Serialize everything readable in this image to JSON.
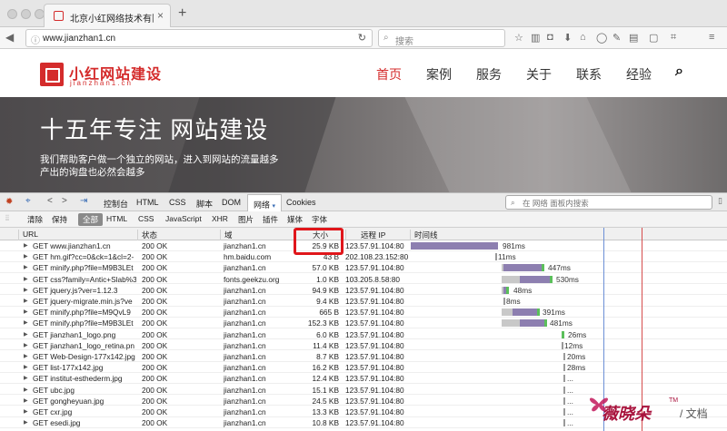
{
  "browser": {
    "tab_title": "北京小红网络技术有限公司-...",
    "url": "www.jianzhan1.cn",
    "search_placeholder": "搜索"
  },
  "site": {
    "logo_title": "小红网站建设",
    "logo_subtitle": "jianzhan1.cn",
    "menu": [
      "首页",
      "案例",
      "服务",
      "关于",
      "联系",
      "经验"
    ],
    "active_menu": "首页",
    "hero_title": "十五年专注 网站建设",
    "hero_desc_line1": "我们帮助客户做一个独立的网站，进入到网站的流量越多",
    "hero_desc_line2": "产出的询盘也必然会越多"
  },
  "devtools": {
    "tabs": [
      "控制台",
      "HTML",
      "CSS",
      "脚本",
      "DOM",
      "网络",
      "Cookies"
    ],
    "active_tab": "网络",
    "search_placeholder": "在 网络 面板内搜索",
    "filters": [
      "清除",
      "保持",
      "全部",
      "HTML",
      "CSS",
      "JavaScript",
      "XHR",
      "图片",
      "插件",
      "媒体",
      "字体"
    ],
    "active_filter": "全部",
    "columns": [
      "URL",
      "状态",
      "域",
      "大小",
      "远程 IP",
      "时间线"
    ],
    "requests": [
      {
        "url": "GET www.jianzhan1.cn",
        "status": "200 OK",
        "domain": "jianzhan1.cn",
        "size": "25.9 KB",
        "ip": "123.57.91.104:80",
        "time": "981ms"
      },
      {
        "url": "GET hm.gif?cc=0&ck=1&cl=2-",
        "status": "200 OK",
        "domain": "hm.baidu.com",
        "size": "43 B",
        "ip": "202.108.23.152:80",
        "time": "11ms"
      },
      {
        "url": "GET minify.php?file=M9B3LEt",
        "status": "200 OK",
        "domain": "jianzhan1.cn",
        "size": "57.0 KB",
        "ip": "123.57.91.104:80",
        "time": "447ms"
      },
      {
        "url": "GET css?family=Antic+Slab%3",
        "status": "200 OK",
        "domain": "fonts.geekzu.org",
        "size": "1.0 KB",
        "ip": "103.205.8.58:80",
        "time": "530ms"
      },
      {
        "url": "GET jquery.js?ver=1.12.3",
        "status": "200 OK",
        "domain": "jianzhan1.cn",
        "size": "94.9 KB",
        "ip": "123.57.91.104:80",
        "time": "48ms"
      },
      {
        "url": "GET jquery-migrate.min.js?ve",
        "status": "200 OK",
        "domain": "jianzhan1.cn",
        "size": "9.4 KB",
        "ip": "123.57.91.104:80",
        "time": "8ms"
      },
      {
        "url": "GET minify.php?file=M9QvL9",
        "status": "200 OK",
        "domain": "jianzhan1.cn",
        "size": "665 B",
        "ip": "123.57.91.104:80",
        "time": "391ms"
      },
      {
        "url": "GET minify.php?file=M9B3LEt",
        "status": "200 OK",
        "domain": "jianzhan1.cn",
        "size": "152.3 KB",
        "ip": "123.57.91.104:80",
        "time": "481ms"
      },
      {
        "url": "GET jianzhan1_logo.png",
        "status": "200 OK",
        "domain": "jianzhan1.cn",
        "size": "6.0 KB",
        "ip": "123.57.91.104:80",
        "time": "26ms"
      },
      {
        "url": "GET jianzhan1_logo_retina.pn",
        "status": "200 OK",
        "domain": "jianzhan1.cn",
        "size": "11.4 KB",
        "ip": "123.57.91.104:80",
        "time": "12ms"
      },
      {
        "url": "GET Web-Design-177x142.jpg",
        "status": "200 OK",
        "domain": "jianzhan1.cn",
        "size": "8.7 KB",
        "ip": "123.57.91.104:80",
        "time": "20ms"
      },
      {
        "url": "GET list-177x142.jpg",
        "status": "200 OK",
        "domain": "jianzhan1.cn",
        "size": "16.2 KB",
        "ip": "123.57.91.104:80",
        "time": "28ms"
      },
      {
        "url": "GET institut-esthederm.jpg",
        "status": "200 OK",
        "domain": "jianzhan1.cn",
        "size": "12.4 KB",
        "ip": "123.57.91.104:80",
        "time": "..."
      },
      {
        "url": "GET ubc.jpg",
        "status": "200 OK",
        "domain": "jianzhan1.cn",
        "size": "15.1 KB",
        "ip": "123.57.91.104:80",
        "time": "..."
      },
      {
        "url": "GET gongheyuan.jpg",
        "status": "200 OK",
        "domain": "jianzhan1.cn",
        "size": "24.5 KB",
        "ip": "123.57.91.104:80",
        "time": "..."
      },
      {
        "url": "GET cxr.jpg",
        "status": "200 OK",
        "domain": "jianzhan1.cn",
        "size": "13.3 KB",
        "ip": "123.57.91.104:80",
        "time": "..."
      },
      {
        "url": "GET esedi.jpg",
        "status": "200 OK",
        "domain": "jianzhan1.cn",
        "size": "10.8 KB",
        "ip": "123.57.91.104:80",
        "time": "..."
      }
    ]
  },
  "watermark": {
    "brand": "薇晓朵",
    "suffix": "文档",
    "tm": "TM"
  },
  "colors": {
    "accent": "#d42b2b",
    "timeline_bar": "#8d7fb0",
    "timeline_recv": "#5bbf5b",
    "highlight_box": "#e0161b"
  }
}
